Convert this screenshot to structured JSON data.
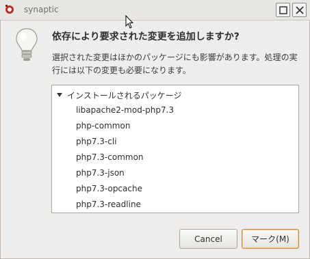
{
  "window": {
    "title": "synaptic"
  },
  "dialog": {
    "heading": "依存により要求された変更を追加しますか?",
    "description": "選択された変更はほかのパッケージにも影響があります。処理の実行には以下の変更も必要になります。"
  },
  "package_list": {
    "group_label": "インストールされるパッケージ",
    "packages": [
      "libapache2-mod-php7.3",
      "php-common",
      "php7.3-cli",
      "php7.3-common",
      "php7.3-json",
      "php7.3-opcache",
      "php7.3-readline"
    ]
  },
  "buttons": {
    "cancel_label": "Cancel",
    "mark_label": "マーク(M)"
  },
  "icons": {
    "app": "synaptic-app-icon",
    "dialog": "lightbulb-icon",
    "maximize": "maximize-icon",
    "close": "close-icon",
    "expander": "expander-down-icon"
  }
}
